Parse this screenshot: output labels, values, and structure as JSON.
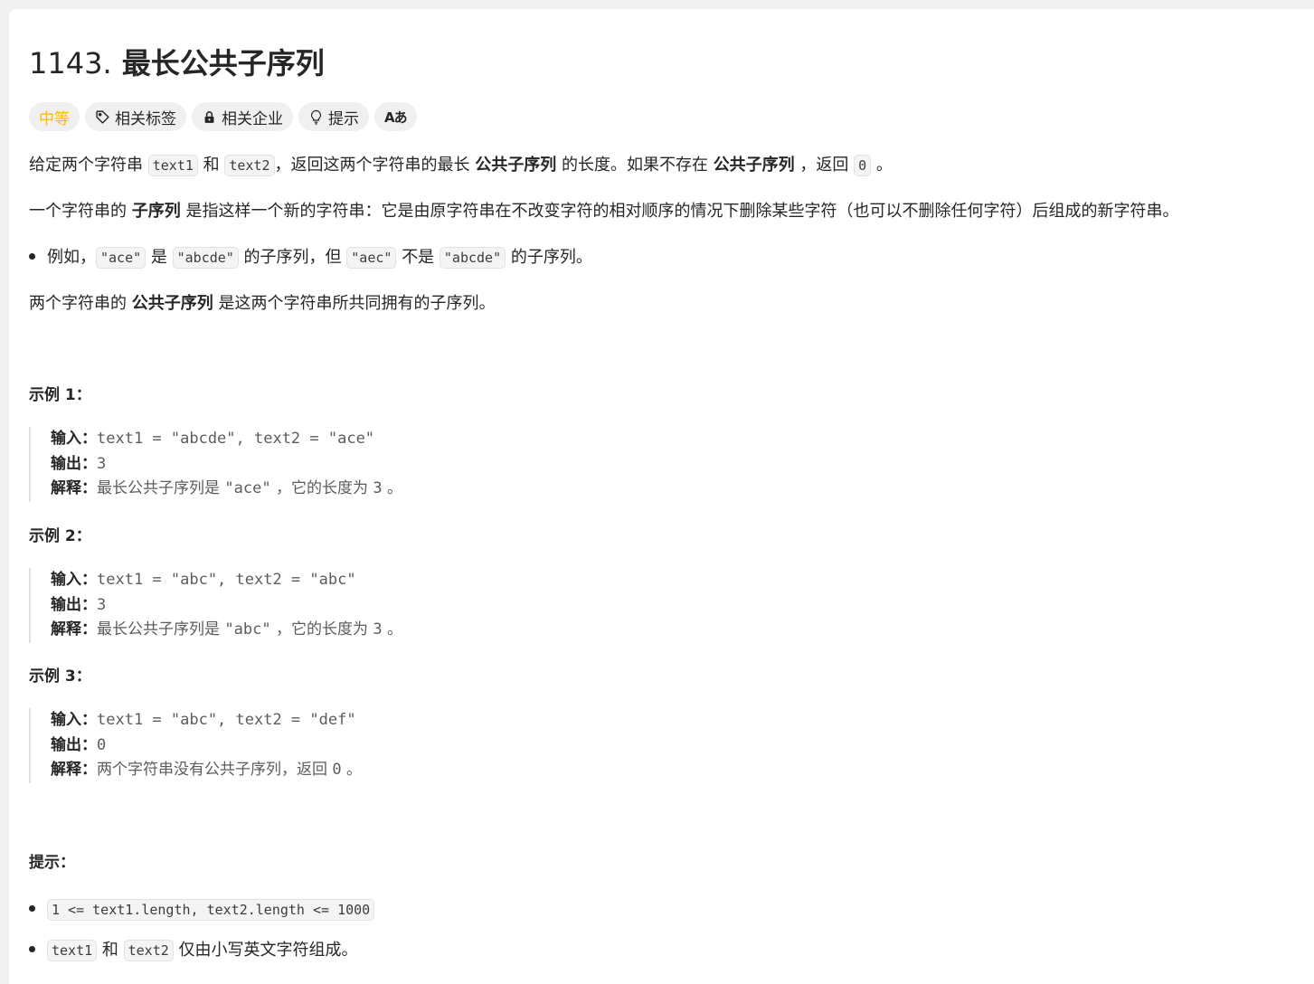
{
  "problem": {
    "number": "1143.",
    "title": "最长公共子序列"
  },
  "tags": {
    "difficulty": "中等",
    "related_tags": "相关标签",
    "related_companies": "相关企业",
    "hint": "提示",
    "translate_icon_text": "Aあ"
  },
  "description": {
    "p1_a": "给定两个字符串 ",
    "p1_code1": "text1",
    "p1_b": " 和 ",
    "p1_code2": "text2",
    "p1_c": "，返回这两个字符串的最长 ",
    "p1_bold1": "公共子序列",
    "p1_d": " 的长度。如果不存在 ",
    "p1_bold2": "公共子序列",
    "p1_e": " ，返回 ",
    "p1_code3": "0",
    "p1_f": " 。",
    "p2_a": "一个字符串的 ",
    "p2_bold": "子序列",
    "p2_b": " 是指这样一个新的字符串：它是由原字符串在不改变字符的相对顺序的情况下删除某些字符（也可以不删除任何字符）后组成的新字符串。",
    "li_a": "例如，",
    "li_code1": "\"ace\"",
    "li_b": " 是 ",
    "li_code2": "\"abcde\"",
    "li_c": " 的子序列，但 ",
    "li_code3": "\"aec\"",
    "li_d": " 不是 ",
    "li_code4": "\"abcde\"",
    "li_e": " 的子序列。",
    "p3_a": "两个字符串的 ",
    "p3_bold": "公共子序列",
    "p3_b": " 是这两个字符串所共同拥有的子序列。"
  },
  "labels": {
    "input": "输入：",
    "output": "输出：",
    "explanation": "解释："
  },
  "examples": [
    {
      "heading": "示例 1：",
      "input": "text1 = \"abcde\", text2 = \"ace\"",
      "output": "3",
      "expl_a": "最长公共子序列是 ",
      "expl_code": "\"ace\"",
      "expl_b": " ，它的长度为 ",
      "expl_num": "3",
      "expl_c": " 。"
    },
    {
      "heading": "示例 2：",
      "input": "text1 = \"abc\", text2 = \"abc\"",
      "output": "3",
      "expl_a": "最长公共子序列是 ",
      "expl_code": "\"abc\"",
      "expl_b": " ，它的长度为 ",
      "expl_num": "3",
      "expl_c": " 。"
    },
    {
      "heading": "示例 3：",
      "input": "text1 = \"abc\", text2 = \"def\"",
      "output": "0",
      "expl_a": "两个字符串没有公共子序列，返回 ",
      "expl_code": "0",
      "expl_b": " 。",
      "expl_num": "",
      "expl_c": ""
    }
  ],
  "constraints": {
    "heading": "提示：",
    "c1": "1 <= text1.length, text2.length <= 1000",
    "c2_code1": "text1",
    "c2_a": " 和 ",
    "c2_code2": "text2",
    "c2_b": " 仅由小写英文字符组成。"
  },
  "icons": {
    "tag": "tag-icon",
    "lock": "lock-icon",
    "bulb": "lightbulb-icon",
    "translate": "translate-icon"
  },
  "colors": {
    "difficulty_medium": "#ffb800",
    "text": "#262626",
    "muted": "#5c5c5c"
  }
}
